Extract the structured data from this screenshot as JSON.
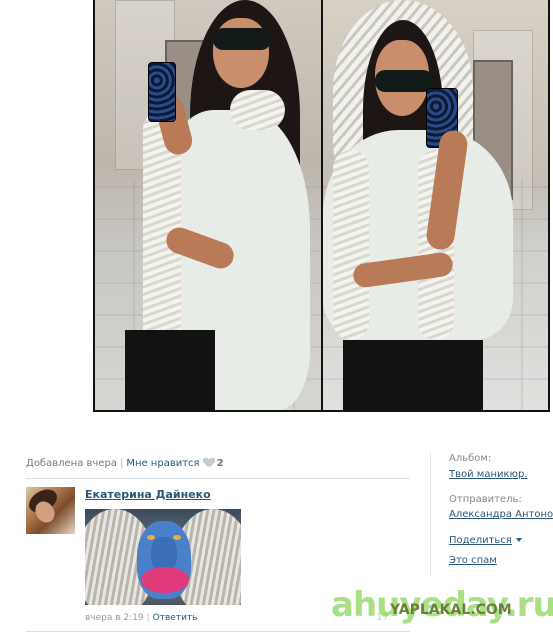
{
  "photo": {
    "alt_left": "",
    "alt_right": ""
  },
  "post_meta": {
    "added": "Добавлена вчера",
    "like_label": "Мне нравится",
    "like_count": "2"
  },
  "comment": {
    "author": "Екатерина Дайнеко",
    "time": "вчера в 2:19",
    "reply": "Ответить"
  },
  "sidebar": {
    "album_label": "Альбом:",
    "album_value": "Твой маникюр.",
    "sender_label": "Отправитель:",
    "sender_value": "Александра Антонова",
    "share": "Поделиться",
    "spam": "Это спам"
  },
  "faded_count": "17",
  "watermark": {
    "primary": "ahuyeday.ru",
    "secondary": "YAPLAKAL.COM"
  },
  "colors": {
    "link": "#2b587a",
    "muted": "#777777",
    "divider": "#dde3ea"
  },
  "icons": [
    "heart-icon",
    "caret-down-icon"
  ]
}
